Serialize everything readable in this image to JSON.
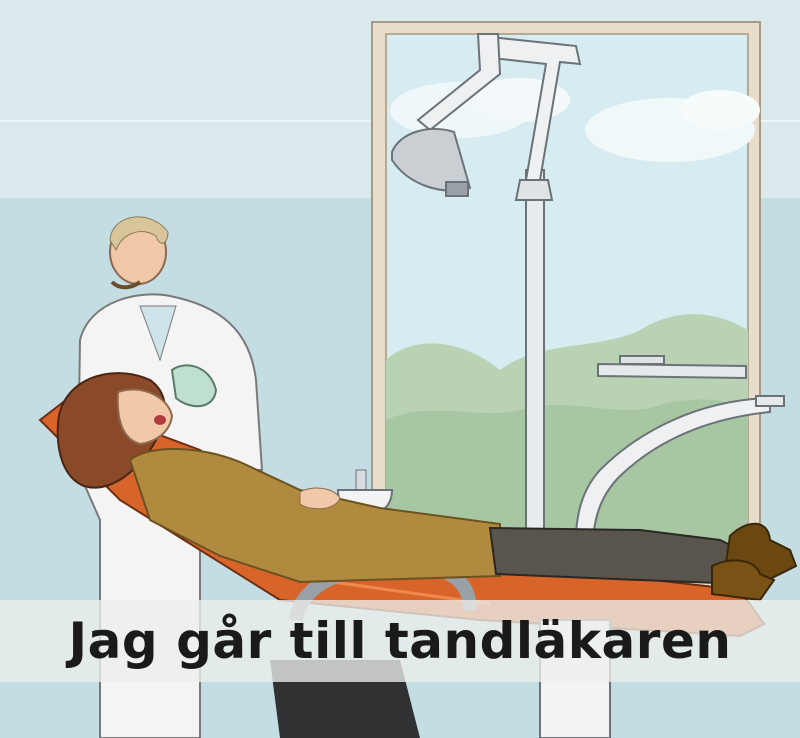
{
  "caption": "Jag går till tandläkaren",
  "colors": {
    "wall_upper": "#dbe9ec",
    "wall_lower": "#c4dde3",
    "window_frame": "#e8dccb",
    "sky": "#d7ecf0",
    "foliage": "#b9d2b3",
    "chair_orange": "#d9642a",
    "patient_jacket": "#b08a3e",
    "patient_hair": "#8a4a2a",
    "trousers": "#5a554c",
    "boots": "#6b4712",
    "lab_coat": "#f4f4f4",
    "equipment": "#e9ecef"
  },
  "scene": {
    "subject": "patient reclining in dental chair with dentist standing beside"
  }
}
